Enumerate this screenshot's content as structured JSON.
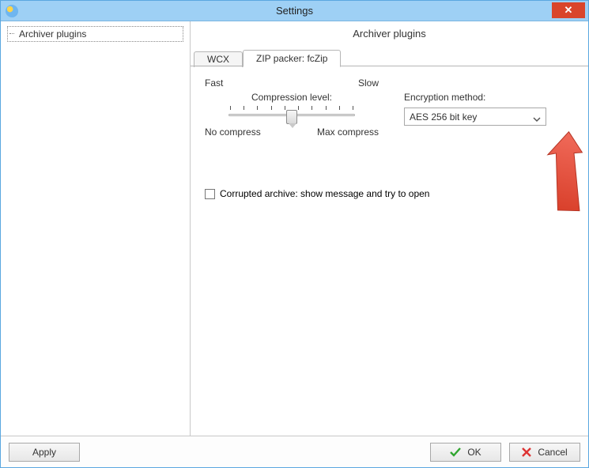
{
  "window": {
    "title": "Settings"
  },
  "sidebar": {
    "items": [
      {
        "label": "Archiver plugins"
      }
    ]
  },
  "panel": {
    "header": "Archiver plugins",
    "tabs": [
      {
        "label": "WCX"
      },
      {
        "label": "ZIP packer: fcZip"
      }
    ],
    "compression": {
      "fast": "Fast",
      "slow": "Slow",
      "label": "Compression level:",
      "no_compress": "No compress",
      "max_compress": "Max compress"
    },
    "encryption": {
      "label": "Encryption method:",
      "value": "AES 256 bit key"
    },
    "corrupted": {
      "label": "Corrupted archive: show message and try to open"
    }
  },
  "buttons": {
    "apply": "Apply",
    "ok": "OK",
    "cancel": "Cancel"
  }
}
